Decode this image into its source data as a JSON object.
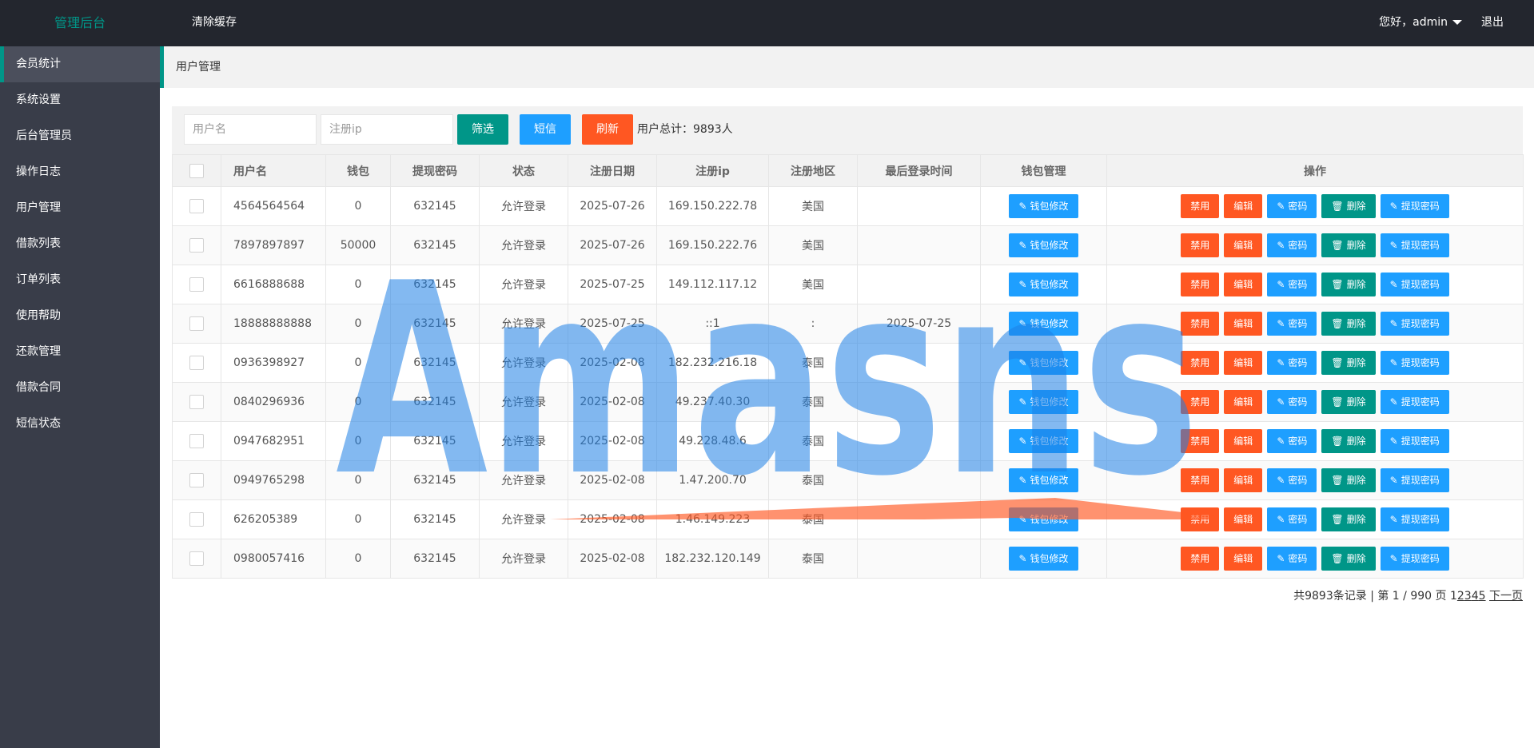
{
  "header": {
    "logo": "管理后台",
    "clear_cache": "清除缓存",
    "greeting": "您好，admin",
    "logout": "退出"
  },
  "sidebar": {
    "items": [
      {
        "label": "会员统计"
      },
      {
        "label": "系统设置"
      },
      {
        "label": "后台管理员"
      },
      {
        "label": "操作日志"
      },
      {
        "label": "用户管理"
      },
      {
        "label": "借款列表"
      },
      {
        "label": "订单列表"
      },
      {
        "label": "使用帮助"
      },
      {
        "label": "还款管理"
      },
      {
        "label": "借款合同"
      },
      {
        "label": "短信状态"
      }
    ]
  },
  "breadcrumb": "用户管理",
  "filters": {
    "username_placeholder": "用户名",
    "ip_placeholder": "注册ip",
    "filter_button": "筛选",
    "sms_button": "短信",
    "refresh_button": "刷新",
    "total": "用户总计：9893人"
  },
  "table": {
    "headers": [
      "用户名",
      "钱包",
      "提现密码",
      "状态",
      "注册日期",
      "注册ip",
      "注册地区",
      "最后登录时间",
      "钱包管理",
      "操作"
    ],
    "rows": [
      {
        "username": "4564564564",
        "wallet": "0",
        "password": "632145",
        "status": "允许登录",
        "date": "2025-07-26",
        "ip": "169.150.222.78",
        "region": "美国",
        "last_login": ""
      },
      {
        "username": "7897897897",
        "wallet": "50000",
        "password": "632145",
        "status": "允许登录",
        "date": "2025-07-26",
        "ip": "169.150.222.76",
        "region": "美国",
        "last_login": ""
      },
      {
        "username": "6616888688",
        "wallet": "0",
        "password": "632145",
        "status": "允许登录",
        "date": "2025-07-25",
        "ip": "149.112.117.12",
        "region": "美国",
        "last_login": ""
      },
      {
        "username": "18888888888",
        "wallet": "0",
        "password": "632145",
        "status": "允许登录",
        "date": "2025-07-25",
        "ip": "::1",
        "region": ":",
        "last_login": "2025-07-25"
      },
      {
        "username": "0936398927",
        "wallet": "0",
        "password": "632145",
        "status": "允许登录",
        "date": "2025-02-08",
        "ip": "182.232.216.18",
        "region": "泰国",
        "last_login": ""
      },
      {
        "username": "0840296936",
        "wallet": "0",
        "password": "632145",
        "status": "允许登录",
        "date": "2025-02-08",
        "ip": "49.237.40.30",
        "region": "泰国",
        "last_login": ""
      },
      {
        "username": "0947682951",
        "wallet": "0",
        "password": "632145",
        "status": "允许登录",
        "date": "2025-02-08",
        "ip": "49.228.48.6",
        "region": "泰国",
        "last_login": ""
      },
      {
        "username": "0949765298",
        "wallet": "0",
        "password": "632145",
        "status": "允许登录",
        "date": "2025-02-08",
        "ip": "1.47.200.70",
        "region": "泰国",
        "last_login": ""
      },
      {
        "username": "626205389",
        "wallet": "0",
        "password": "632145",
        "status": "允许登录",
        "date": "2025-02-08",
        "ip": "1.46.149.223",
        "region": "泰国",
        "last_login": ""
      },
      {
        "username": "0980057416",
        "wallet": "0",
        "password": "632145",
        "status": "允许登录",
        "date": "2025-02-08",
        "ip": "182.232.120.149",
        "region": "泰国",
        "last_login": ""
      }
    ],
    "wallet_btn": "钱包修改",
    "actions": {
      "ban": "禁用",
      "edit": "编辑",
      "password": "密码",
      "delete": "删除",
      "withdraw_pw": "提现密码"
    }
  },
  "pager": {
    "summary": "共9893条记录 | 第 1 / 990 页 1",
    "pages": [
      "2",
      "3",
      "4",
      "5"
    ],
    "next": "下一页"
  },
  "watermark": "Amasns",
  "colors": {
    "topbar": "#23262e",
    "sidebar": "#393d49",
    "accent": "#009688",
    "blue": "#1e9fff",
    "orange": "#ff5722"
  }
}
